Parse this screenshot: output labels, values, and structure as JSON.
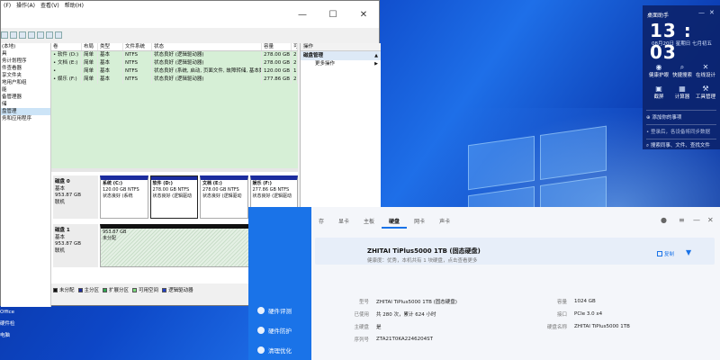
{
  "disk_mgmt": {
    "menu": [
      "(F)",
      "操作(A)",
      "查看(V)",
      "帮助(H)"
    ],
    "tree_items": [
      "(本地)",
      "具",
      "务计划程序",
      "件查看器",
      "享文件夹",
      "地用户和组",
      "能",
      "备管理器",
      "储",
      "盘管理",
      "务和应用程序"
    ],
    "tree_selected": 9,
    "columns": [
      "卷",
      "布局",
      "类型",
      "文件系统",
      "状态",
      "容量",
      "可"
    ],
    "volumes": [
      {
        "vol": "• 软件 (D:)",
        "layout": "简单",
        "type": "基本",
        "fs": "NTFS",
        "status": "状态良好 (逻辑驱动器)",
        "cap": "278.00 GB",
        "free": "2"
      },
      {
        "vol": "• 文档 (E:)",
        "layout": "简单",
        "type": "基本",
        "fs": "NTFS",
        "status": "状态良好 (逻辑驱动器)",
        "cap": "278.00 GB",
        "free": "2"
      },
      {
        "vol": "•",
        "layout": "简单",
        "type": "基本",
        "fs": "NTFS",
        "status": "状态良好 (系统, 启动, 页面文件, 故障转储, 基本数据分区)",
        "cap": "120.00 GB",
        "free": "1"
      },
      {
        "vol": "• 娱乐 (F:)",
        "layout": "简单",
        "type": "基本",
        "fs": "NTFS",
        "status": "状态良好 (逻辑驱动器)",
        "cap": "277.86 GB",
        "free": "2"
      }
    ],
    "ops_title": "操作",
    "ops_section": "磁盘管理",
    "ops_more": "更多操作",
    "disks": [
      {
        "name": "磁盘 0",
        "kind": "基本",
        "size": "953.87 GB",
        "state": "联机",
        "parts": [
          {
            "name": "系统 (C:)",
            "size": "120.00 GB NTFS",
            "status": "状态良好 (系统",
            "selected": false
          },
          {
            "name": "软件 (D:)",
            "size": "278.00 GB NTFS",
            "status": "状态良好 (逻辑驱动",
            "selected": true
          },
          {
            "name": "文档 (E:)",
            "size": "278.00 GB NTFS",
            "status": "状态良好 (逻辑驱动",
            "selected": false
          },
          {
            "name": "娱乐 (F:)",
            "size": "277.86 GB NTFS",
            "status": "状态良好 (逻辑驱动",
            "selected": false
          }
        ]
      },
      {
        "name": "磁盘 1",
        "kind": "基本",
        "size": "953.87 GB",
        "state": "联机",
        "parts": [
          {
            "name": "",
            "size": "953.87 GB",
            "status": "未分配",
            "unalloc": true
          }
        ]
      }
    ],
    "legend": [
      {
        "label": "未分配",
        "color": "#111111"
      },
      {
        "label": "主分区",
        "color": "#1b2c9e"
      },
      {
        "label": "扩展分区",
        "color": "#2fa84f"
      },
      {
        "label": "可用空间",
        "color": "#7ddc7d"
      },
      {
        "label": "逻辑驱动器",
        "color": "#2040c8"
      }
    ]
  },
  "desktop_icons": [
    "Office",
    "硬件检",
    "电脑"
  ],
  "hardware": {
    "sidebar": [
      "硬件评测",
      "硬件防护",
      "清理优化"
    ],
    "tabs": [
      "存",
      "显卡",
      "主板",
      "硬盘",
      "网卡",
      "声卡"
    ],
    "active_tab": 3,
    "disk_name": "ZHITAI TiPlus5000 1TB (固态硬盘)",
    "disk_sub": "健康度：优秀，本机共有 1 块硬盘，点击查看更多",
    "copy_label": "复制",
    "specs": [
      {
        "k1": "型号",
        "v1": "ZHITAI TiPlus5000 1TB (固态硬盘)",
        "k2": "容量",
        "v2": "1024 GB"
      },
      {
        "k1": "已使用",
        "v1": "共 280 次，累计 624 小时",
        "k2": "接口",
        "v2": "PCIe 3.0 x4"
      },
      {
        "k1": "主硬盘",
        "v1": "是",
        "k2": "硬盘名称",
        "v2": "ZHITAI TiPlus5000 1TB"
      },
      {
        "k1": "序列号",
        "v1": "ZTA21T0KA2246204ST",
        "k2": "",
        "v2": ""
      }
    ]
  },
  "panel": {
    "title": "桌面助手",
    "time": "13 : 03",
    "date": "08月20日  星期日  七月初五",
    "actions_row1": [
      {
        "label": "健康护眼",
        "icon": "◉"
      },
      {
        "label": "快捷搜索",
        "icon": "⌕"
      },
      {
        "label": "在线设计",
        "icon": "✕"
      }
    ],
    "actions_row2": [
      {
        "label": "截屏",
        "icon": "▣"
      },
      {
        "label": "计算器",
        "icon": "▦"
      },
      {
        "label": "工具管理",
        "icon": "⚒"
      }
    ],
    "add_event": "添加你的事项",
    "login_hint": "登录后，各设备将同步数据",
    "search_hint": "搜索同事、文件、查找文件"
  }
}
